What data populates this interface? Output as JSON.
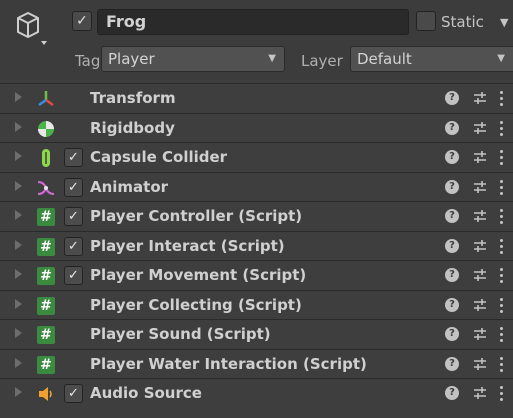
{
  "header": {
    "object_name": "Frog",
    "active": true,
    "static_label": "Static",
    "tag_label": "Tag",
    "tag_value": "Player",
    "layer_label": "Layer",
    "layer_value": "Default"
  },
  "components": [
    {
      "name": "Transform",
      "icon": "transform-icon",
      "has_checkbox": false
    },
    {
      "name": "Rigidbody",
      "icon": "rigidbody-icon",
      "has_checkbox": false
    },
    {
      "name": "Capsule Collider",
      "icon": "capsule-collider-icon",
      "has_checkbox": true,
      "checked": true
    },
    {
      "name": "Animator",
      "icon": "animator-icon",
      "has_checkbox": true,
      "checked": true
    },
    {
      "name": "Player Controller (Script)",
      "icon": "script-icon",
      "has_checkbox": true,
      "checked": true
    },
    {
      "name": "Player Interact (Script)",
      "icon": "script-icon",
      "has_checkbox": true,
      "checked": true
    },
    {
      "name": "Player Movement (Script)",
      "icon": "script-icon",
      "has_checkbox": true,
      "checked": true
    },
    {
      "name": "Player Collecting (Script)",
      "icon": "script-icon",
      "has_checkbox": false
    },
    {
      "name": "Player Sound (Script)",
      "icon": "script-icon",
      "has_checkbox": false
    },
    {
      "name": "Player Water Interaction (Script)",
      "icon": "script-icon",
      "has_checkbox": false
    },
    {
      "name": "Audio Source",
      "icon": "audio-source-icon",
      "has_checkbox": true,
      "checked": true
    }
  ],
  "glyphs": {
    "check": "✓",
    "help": "?",
    "dropdown": "▼",
    "script": "#"
  }
}
